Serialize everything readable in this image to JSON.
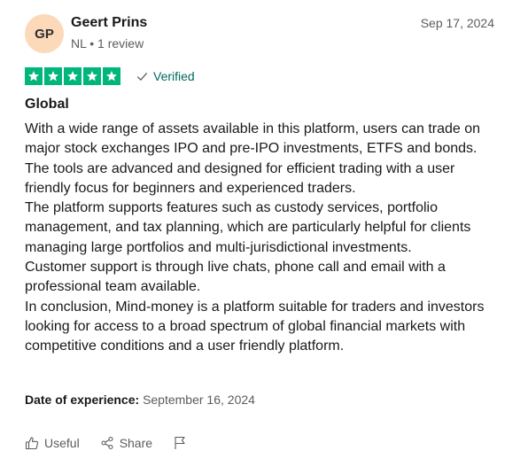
{
  "reviewer": {
    "initials": "GP",
    "name": "Geert Prins",
    "meta": "NL • 1 review"
  },
  "review_date": "Sep 17, 2024",
  "rating": {
    "stars": 5,
    "max": 5,
    "color": "#00b67a"
  },
  "verified_label": "Verified",
  "review": {
    "title": "Global",
    "lines": [
      "With a wide range of assets available in this platform, users can trade on major stock exchanges IPO and pre-IPO investments, ETFS and bonds.",
      "The tools are advanced and designed for efficient trading with a user friendly focus for beginners and experienced traders.",
      "The platform supports features such as custody services, portfolio management, and tax planning, which are particularly helpful for clients managing large portfolios and multi-jurisdictional investments.",
      "Customer support is through live chats, phone call and email with a professional team available.",
      "In conclusion, Mind-money is a platform suitable for traders and investors looking for access to a broad spectrum of global financial markets with competitive conditions and a user friendly platform."
    ]
  },
  "experience": {
    "label": "Date of experience:",
    "value": "September 16, 2024"
  },
  "actions": {
    "useful_label": "Useful",
    "share_label": "Share"
  },
  "icons": {
    "verified": "check-icon",
    "useful": "thumbs-up-icon",
    "share": "share-icon",
    "report": "flag-icon"
  }
}
